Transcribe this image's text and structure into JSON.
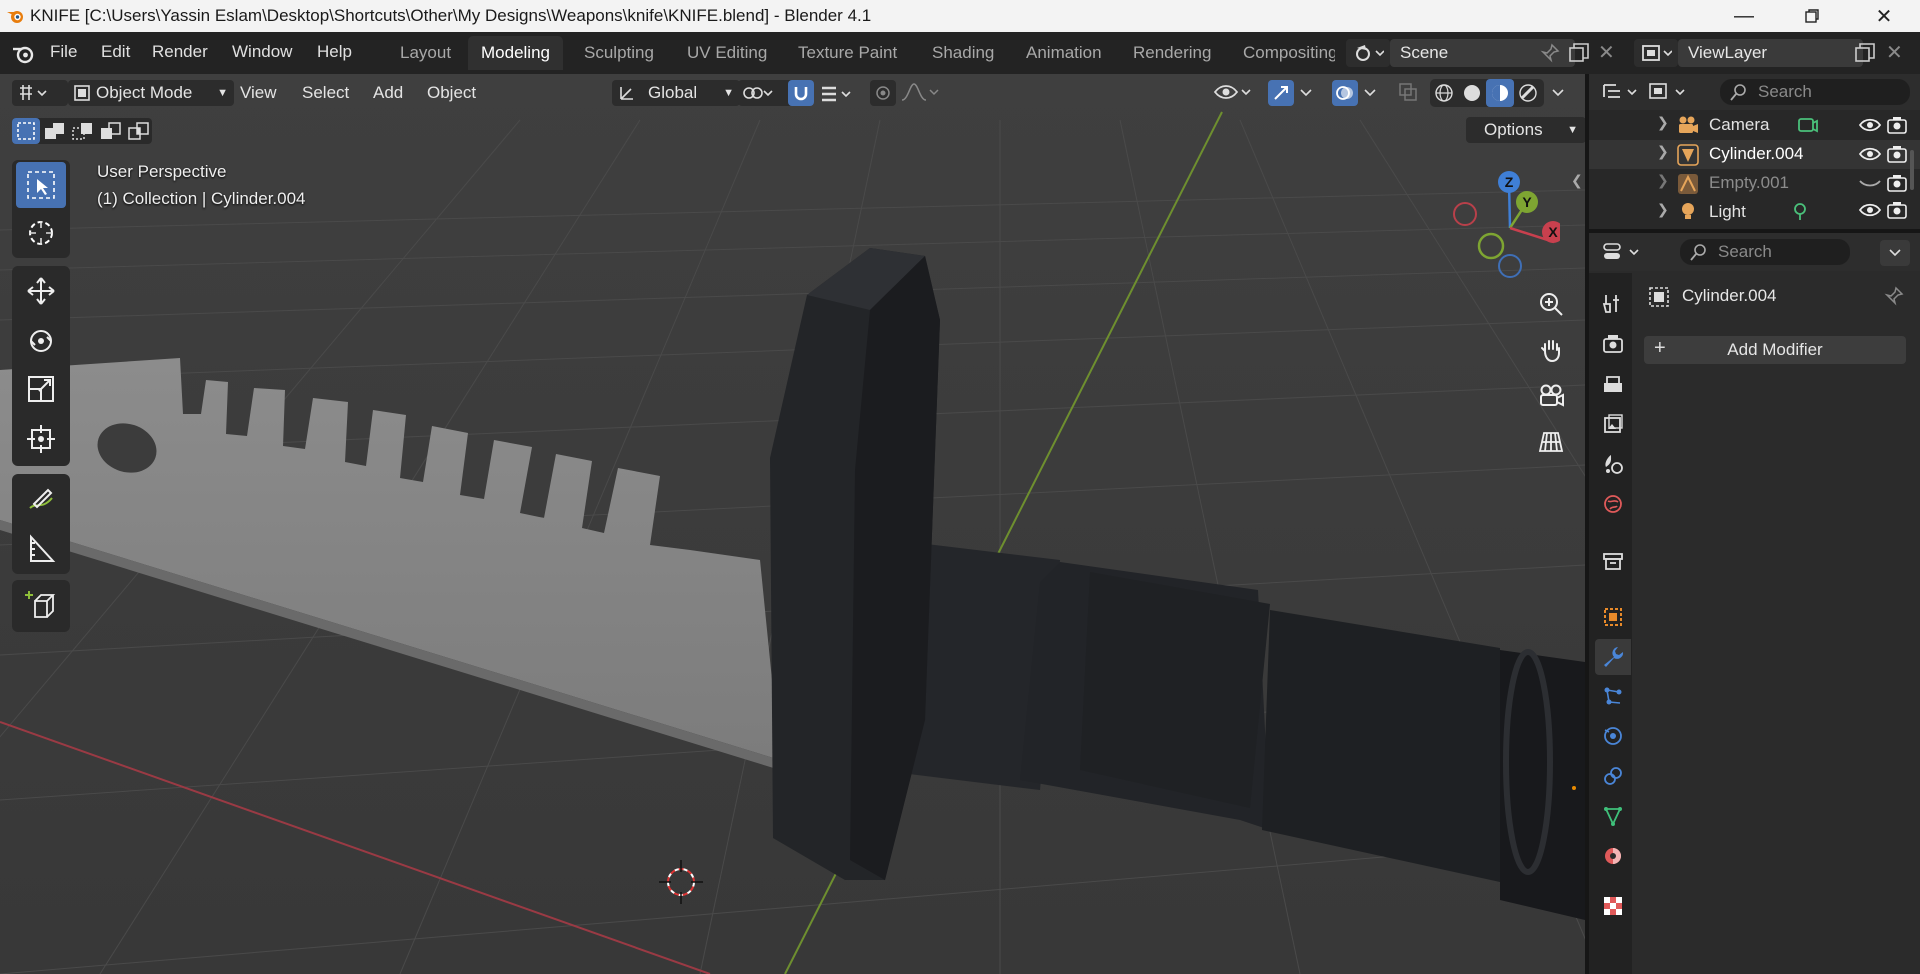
{
  "window": {
    "title": "KNIFE [C:\\Users\\Yassin Eslam\\Desktop\\Shortcuts\\Other\\My Designs\\Weapons\\knife\\KNIFE.blend] - Blender 4.1",
    "controls": [
      "minimize-icon",
      "restore-icon",
      "close-icon"
    ]
  },
  "menu": {
    "items": [
      "File",
      "Edit",
      "Render",
      "Window",
      "Help"
    ]
  },
  "workspaces": {
    "tabs": [
      "Layout",
      "Modeling",
      "Sculpting",
      "UV Editing",
      "Texture Paint",
      "Shading",
      "Animation",
      "Rendering",
      "Compositing"
    ],
    "active": "Modeling"
  },
  "scene": {
    "name": "Scene"
  },
  "view_layer": {
    "name": "ViewLayer"
  },
  "viewport_header": {
    "mode": "Object Mode",
    "menus": [
      "View",
      "Select",
      "Add",
      "Object"
    ],
    "orientation": "Global",
    "options_label": "Options"
  },
  "viewport": {
    "perspective": "User Perspective",
    "collection_info": "(1) Collection | Cylinder.004",
    "gizmo_axes": {
      "x": "X",
      "y": "Y",
      "z": "Z"
    },
    "colors": {
      "x_axis": "#c8404e",
      "y_axis": "#7ea532",
      "z_axis": "#3f7fd6",
      "tool_active": "#4772b3"
    }
  },
  "outliner": {
    "search_placeholder": "Search",
    "items": [
      {
        "name": "Camera",
        "icon": "camera-icon"
      },
      {
        "name": "Cylinder.004",
        "icon": "mesh-icon"
      },
      {
        "name": "Empty.001",
        "icon": "empty-icon"
      },
      {
        "name": "Light",
        "icon": "light-icon"
      }
    ]
  },
  "properties": {
    "search_placeholder": "Search",
    "object_name": "Cylinder.004",
    "add_modifier_label": "Add Modifier",
    "tabs": [
      "tool-icon",
      "render-icon",
      "output-icon",
      "view-layer-icon",
      "scene-icon",
      "world-icon",
      "collection-icon",
      "object-icon",
      "modifier-icon",
      "particles-icon",
      "physics-icon",
      "constraints-icon",
      "data-icon",
      "material-icon",
      "texture-icon"
    ],
    "active_tab": "modifier-icon"
  }
}
